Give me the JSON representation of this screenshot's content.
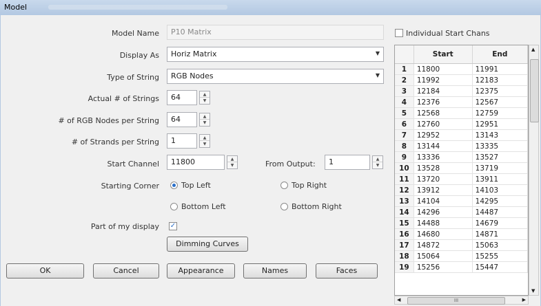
{
  "window": {
    "title": "Model"
  },
  "form": {
    "model_name_label": "Model Name",
    "model_name_value": "P10 Matrix",
    "display_as_label": "Display As",
    "display_as_value": "Horiz Matrix",
    "type_of_string_label": "Type of String",
    "type_of_string_value": "RGB Nodes",
    "actual_strings_label": "Actual # of Strings",
    "actual_strings_value": "64",
    "nodes_per_string_label": "# of RGB Nodes per String",
    "nodes_per_string_value": "64",
    "strands_per_string_label": "# of Strands per String",
    "strands_per_string_value": "1",
    "start_channel_label": "Start Channel",
    "start_channel_value": "11800",
    "from_output_label": "From Output:",
    "from_output_value": "1",
    "starting_corner_label": "Starting Corner",
    "corner_top_left": "Top Left",
    "corner_top_right": "Top Right",
    "corner_bottom_left": "Bottom Left",
    "corner_bottom_right": "Bottom Right",
    "part_of_display_label": "Part of my display",
    "dimming_curves_label": "Dimming Curves"
  },
  "buttons": {
    "ok": "OK",
    "cancel": "Cancel",
    "appearance": "Appearance",
    "names": "Names",
    "faces": "Faces"
  },
  "channels": {
    "individual_start_label": "Individual Start Chans",
    "col_start": "Start",
    "col_end": "End",
    "rows": [
      {
        "n": "1",
        "start": "11800",
        "end": "11991"
      },
      {
        "n": "2",
        "start": "11992",
        "end": "12183"
      },
      {
        "n": "3",
        "start": "12184",
        "end": "12375"
      },
      {
        "n": "4",
        "start": "12376",
        "end": "12567"
      },
      {
        "n": "5",
        "start": "12568",
        "end": "12759"
      },
      {
        "n": "6",
        "start": "12760",
        "end": "12951"
      },
      {
        "n": "7",
        "start": "12952",
        "end": "13143"
      },
      {
        "n": "8",
        "start": "13144",
        "end": "13335"
      },
      {
        "n": "9",
        "start": "13336",
        "end": "13527"
      },
      {
        "n": "10",
        "start": "13528",
        "end": "13719"
      },
      {
        "n": "11",
        "start": "13720",
        "end": "13911"
      },
      {
        "n": "12",
        "start": "13912",
        "end": "14103"
      },
      {
        "n": "13",
        "start": "14104",
        "end": "14295"
      },
      {
        "n": "14",
        "start": "14296",
        "end": "14487"
      },
      {
        "n": "15",
        "start": "14488",
        "end": "14679"
      },
      {
        "n": "16",
        "start": "14680",
        "end": "14871"
      },
      {
        "n": "17",
        "start": "14872",
        "end": "15063"
      },
      {
        "n": "18",
        "start": "15064",
        "end": "15255"
      },
      {
        "n": "19",
        "start": "15256",
        "end": "15447"
      }
    ]
  },
  "hscroll_thumb_text": "III"
}
